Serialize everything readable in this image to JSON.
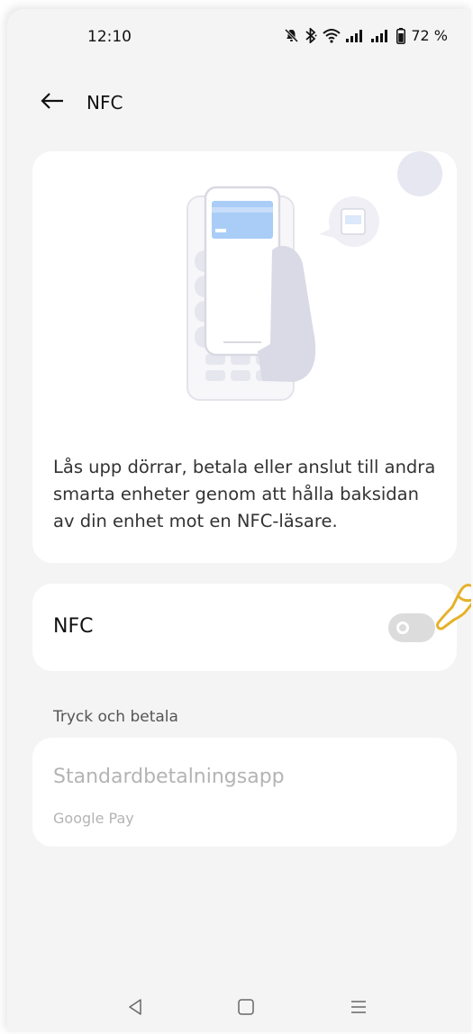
{
  "status_bar": {
    "time": "12:10",
    "battery": "72 %",
    "icons": [
      "bell-off-icon",
      "bluetooth-icon",
      "wifi-icon",
      "signal-icon",
      "signal-icon",
      "battery-icon"
    ]
  },
  "header": {
    "back_icon": "arrow-left-icon",
    "title": "NFC"
  },
  "intro": {
    "text": "Lås upp dörrar, betala eller anslut till andra smarta enheter genom att hålla baksidan av din enhet mot en NFC-läsare."
  },
  "nfc_setting": {
    "label": "NFC",
    "enabled": false
  },
  "tap_and_pay": {
    "section_title": "Tryck och betala",
    "default_app_title": "Standardbetalningsapp",
    "default_app_value": "Google Pay"
  },
  "nav_bar": {
    "icons": [
      "back-triangle-icon",
      "home-square-icon",
      "menu-lines-icon"
    ]
  },
  "colors": {
    "background": "#f4f4f4",
    "card": "#ffffff",
    "toggle_off": "#dcdcdc",
    "disabled_text": "#b4b4b4",
    "accent_illustration": "#a9cdf7",
    "pointer_hand": "#e6b12a"
  }
}
